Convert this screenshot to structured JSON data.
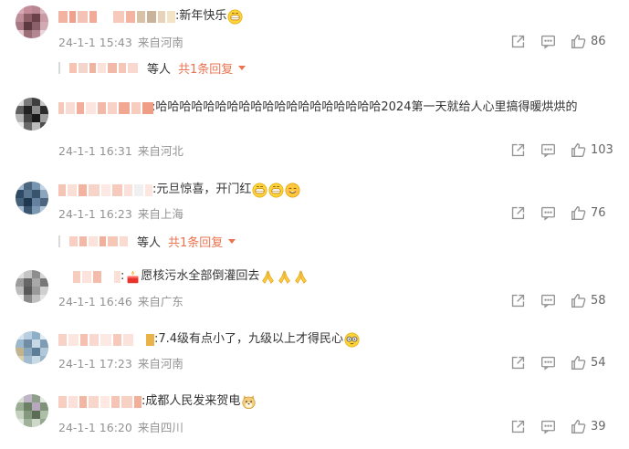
{
  "comments": [
    {
      "text": ":新年快乐",
      "emojis": [
        "grin-emoji"
      ],
      "time": "24-1-1 15:43",
      "location": "来自河南",
      "likes": "86",
      "reply": {
        "deng": "等人",
        "total": "共1条回复"
      }
    },
    {
      "text": ":哈哈哈哈哈哈哈哈哈哈哈哈哈哈哈哈哈哈哈2024第一天就给人心里搞得暖烘烘的",
      "emojis": [],
      "time": "24-1-1 16:31",
      "location": "来自河北",
      "likes": "103"
    },
    {
      "text": ":元旦惊喜，开门红",
      "emojis": [
        "grin-emoji",
        "grin-emoji",
        "smile-emoji"
      ],
      "time": "24-1-1 16:23",
      "location": "来自上海",
      "likes": "76",
      "reply": {
        "deng": "等人",
        "total": "共1条回复"
      }
    },
    {
      "text": "愿核污水全部倒灌回去",
      "prefix": ":",
      "emojis_before": [
        "candle-emoji"
      ],
      "emojis": [
        "pray-emoji",
        "pray-emoji",
        "pray-emoji"
      ],
      "time": "24-1-1 16:46",
      "location": "来自广东",
      "likes": "58"
    },
    {
      "text": ":7.4级有点小了，九级以上才得民心",
      "emojis": [
        "eyeglasses-emoji"
      ],
      "time": "24-1-1 17:23",
      "location": "来自河南",
      "likes": "54"
    },
    {
      "text": ":成都人民发来贺电",
      "emojis": [
        "doge-emoji"
      ],
      "time": "24-1-1 16:20",
      "location": "来自四川",
      "likes": "39"
    }
  ],
  "colors": {
    "accent": "#eb7350",
    "meta": "#939393",
    "text": "#333333"
  }
}
